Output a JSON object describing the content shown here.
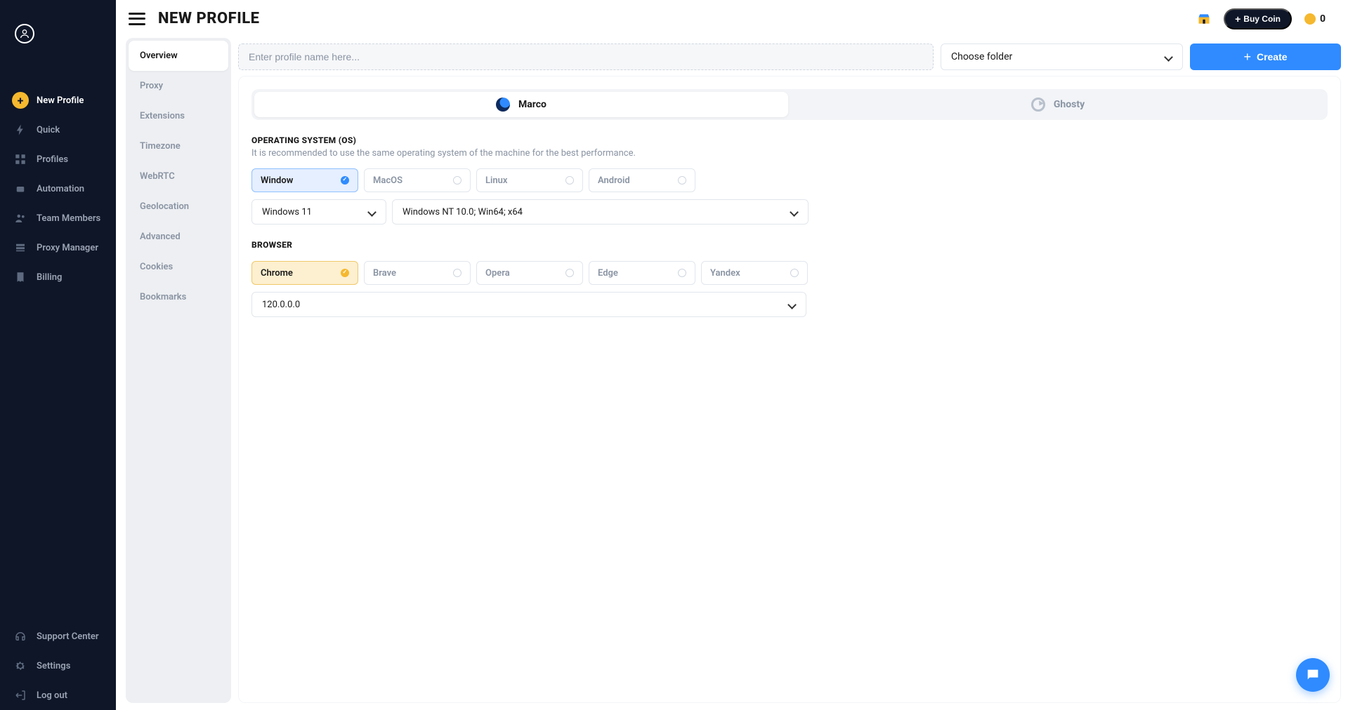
{
  "page_title": "NEW PROFILE",
  "topbar": {
    "buy_coin": "Buy Coin",
    "coin_balance": "0"
  },
  "sidebar": {
    "items": [
      {
        "label": "New Profile",
        "primary": true
      },
      {
        "label": "Quick"
      },
      {
        "label": "Profiles"
      },
      {
        "label": "Automation"
      },
      {
        "label": "Team Members"
      },
      {
        "label": "Proxy Manager"
      },
      {
        "label": "Billing"
      }
    ],
    "footer": [
      {
        "label": "Support Center"
      },
      {
        "label": "Settings"
      },
      {
        "label": "Log out"
      }
    ]
  },
  "tabs": [
    {
      "label": "Overview",
      "active": true
    },
    {
      "label": "Proxy"
    },
    {
      "label": "Extensions"
    },
    {
      "label": "Timezone"
    },
    {
      "label": "WebRTC"
    },
    {
      "label": "Geolocation"
    },
    {
      "label": "Advanced"
    },
    {
      "label": "Cookies"
    },
    {
      "label": "Bookmarks"
    }
  ],
  "form": {
    "name_placeholder": "Enter profile name here...",
    "folder_placeholder": "Choose folder",
    "create_label": "Create"
  },
  "modes": [
    {
      "label": "Marco",
      "active": true
    },
    {
      "label": "Ghosty"
    }
  ],
  "os": {
    "title": "OPERATING SYSTEM (OS)",
    "subtitle": "It is recommended to use the same operating system of the machine for the best performance.",
    "options": [
      "Window",
      "MacOS",
      "Linux",
      "Android"
    ],
    "selected": "Window",
    "version": "Windows 11",
    "ua": "Windows NT 10.0; Win64; x64"
  },
  "browser": {
    "title": "BROWSER",
    "options": [
      "Chrome",
      "Brave",
      "Opera",
      "Edge",
      "Yandex"
    ],
    "selected": "Chrome",
    "version": "120.0.0.0"
  }
}
